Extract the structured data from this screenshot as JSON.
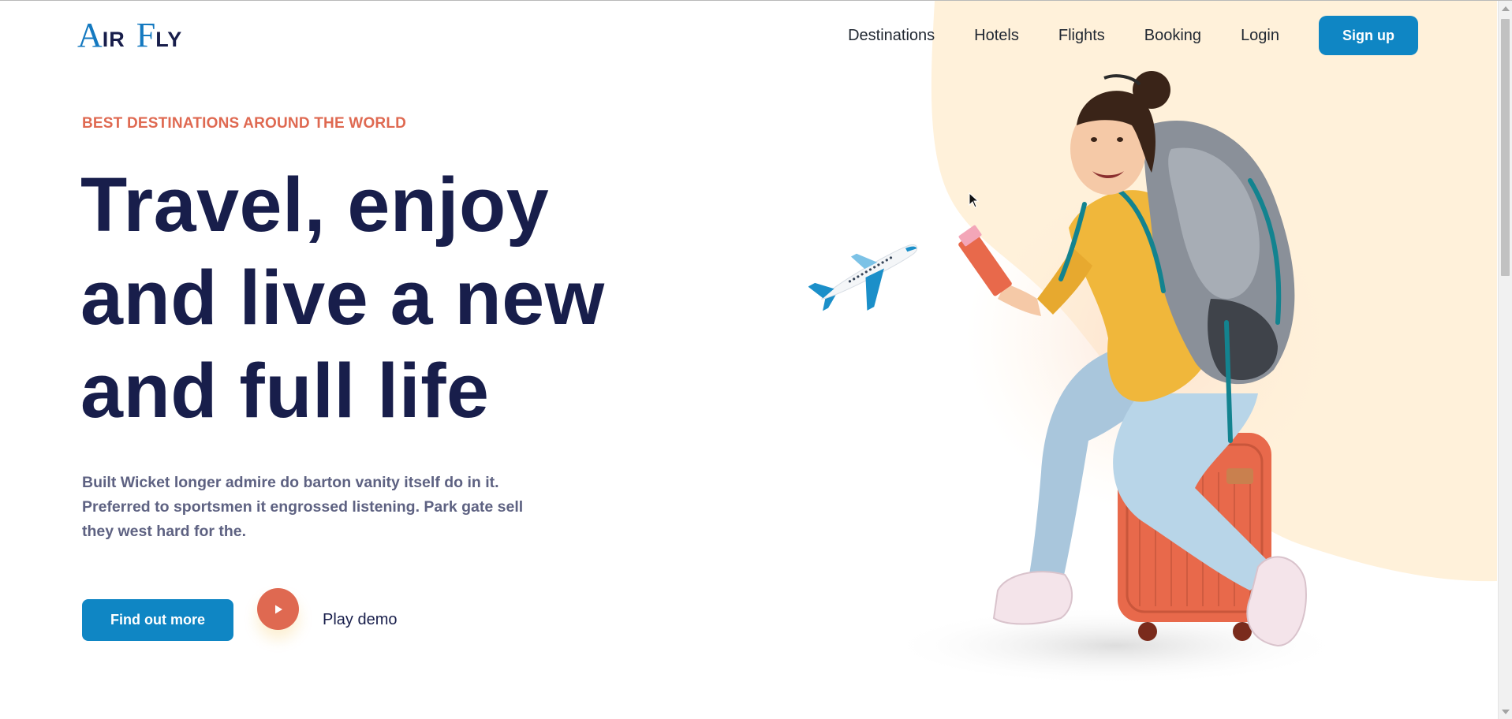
{
  "brand": {
    "logo_cap1": "A",
    "logo_rest1": "IR",
    "logo_cap2": "F",
    "logo_rest2": "LY",
    "accent_color": "#0f86c4",
    "secondary_color": "#df6951",
    "heading_color": "#181e4b"
  },
  "nav": {
    "items": [
      {
        "label": "Destinations"
      },
      {
        "label": "Hotels"
      },
      {
        "label": "Flights"
      },
      {
        "label": "Booking"
      },
      {
        "label": "Login"
      }
    ],
    "signup_label": "Sign up"
  },
  "hero": {
    "eyebrow": "BEST DESTINATIONS AROUND THE WORLD",
    "headline_lines": [
      "Travel, enjoy",
      "and live a new",
      "and full life"
    ],
    "description": "Built Wicket longer admire do barton vanity itself do in it. Preferred to sportsmen it engrossed listening. Park gate sell they west hard for the.",
    "cta_label": "Find out more",
    "play_label": "Play demo",
    "play_icon": "play-icon"
  },
  "illustrations": {
    "plane_icon": "airplane-icon",
    "traveler_image": "traveler-with-backpack-on-suitcase"
  }
}
